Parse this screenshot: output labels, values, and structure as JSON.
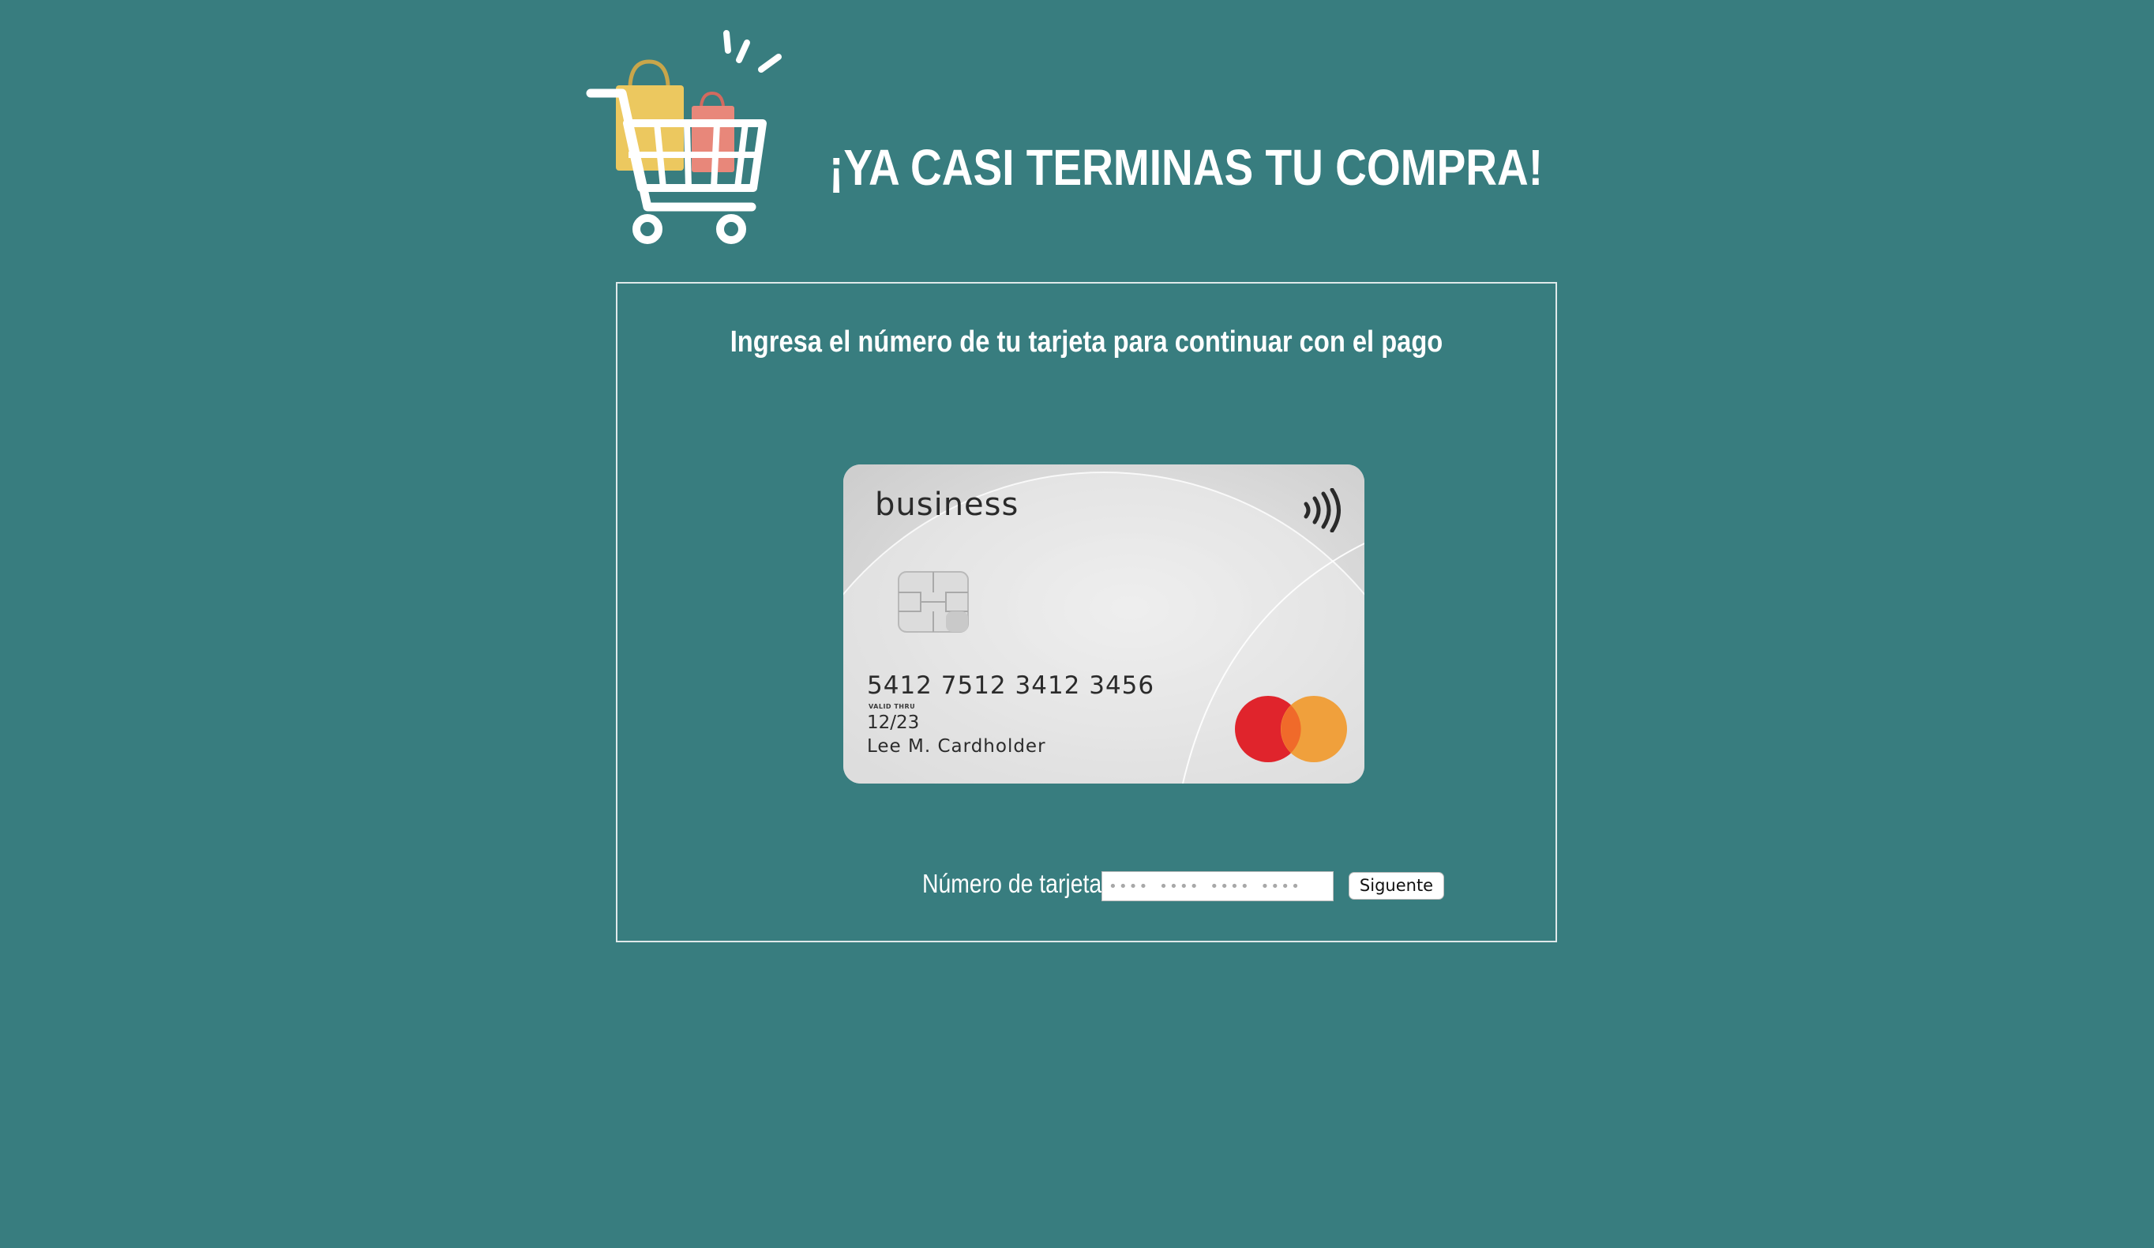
{
  "header": {
    "title": "¡YA CASI TERMINAS TU COMPRA!",
    "logo_icon": "shopping-cart-with-bags-icon"
  },
  "checkout": {
    "instruction": "Ingresa el número de tu tarjeta para continuar con el pago",
    "card_image": {
      "brand": "business",
      "number": "5412 7512 3412 3456",
      "valid_thru_label": "VALID THRU",
      "expiry": "12/23",
      "holder": "Lee M. Cardholder",
      "network_icon": "mastercard-logo",
      "contactless_icon": "contactless-icon",
      "chip_icon": "chip-icon"
    },
    "form": {
      "card_number_label": "Número de tarjeta:",
      "card_number_placeholder": "•••• •••• •••• ••••",
      "card_number_value": "",
      "next_button_label": "Siguente"
    }
  },
  "colors": {
    "background": "#387d7f",
    "text": "#ffffff",
    "bag_yellow": "#ecc85f",
    "bag_pink": "#e8877a",
    "mastercard_red": "#e0242c",
    "mastercard_orange": "#f0a03c"
  }
}
